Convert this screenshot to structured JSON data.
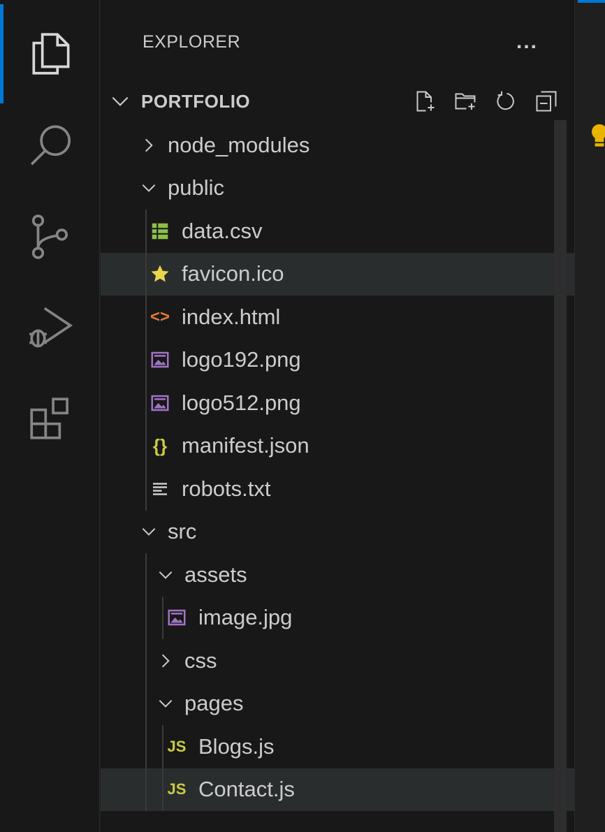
{
  "sidebar": {
    "title": "EXPLORER",
    "more": "...",
    "folder": "PORTFOLIO"
  },
  "tree": [
    {
      "label": "node_modules",
      "type": "folder",
      "expanded": false,
      "depth": 1
    },
    {
      "label": "public",
      "type": "folder",
      "expanded": true,
      "depth": 1
    },
    {
      "label": "data.csv",
      "type": "file",
      "icon": "csv-icon",
      "depth": 2
    },
    {
      "label": "favicon.ico",
      "type": "file",
      "icon": "star-icon",
      "depth": 2,
      "hover": true
    },
    {
      "label": "index.html",
      "type": "file",
      "icon": "html-icon",
      "depth": 2
    },
    {
      "label": "logo192.png",
      "type": "file",
      "icon": "image-icon",
      "depth": 2
    },
    {
      "label": "logo512.png",
      "type": "file",
      "icon": "image-icon",
      "depth": 2
    },
    {
      "label": "manifest.json",
      "type": "file",
      "icon": "json-icon",
      "depth": 2
    },
    {
      "label": "robots.txt",
      "type": "file",
      "icon": "text-icon",
      "depth": 2
    },
    {
      "label": "src",
      "type": "folder",
      "expanded": true,
      "depth": 1
    },
    {
      "label": "assets",
      "type": "folder",
      "expanded": true,
      "depth": 2
    },
    {
      "label": "image.jpg",
      "type": "file",
      "icon": "image-icon",
      "depth": 3
    },
    {
      "label": "css",
      "type": "folder",
      "expanded": false,
      "depth": 2
    },
    {
      "label": "pages",
      "type": "folder",
      "expanded": true,
      "depth": 2
    },
    {
      "label": "Blogs.js",
      "type": "file",
      "icon": "js-icon",
      "depth": 3
    },
    {
      "label": "Contact.js",
      "type": "file",
      "icon": "js-icon",
      "depth": 3,
      "hover": true
    }
  ],
  "icons": {
    "js_text": "JS",
    "json_text": "{}",
    "html_text": "<>"
  },
  "colors": {
    "accent": "#0078d4",
    "csv": "#8dc149",
    "star": "#e8d44d",
    "html": "#e37933",
    "image": "#a074c4",
    "json": "#cbcb41",
    "js": "#cbcb41",
    "bulb": "#e8b400"
  }
}
